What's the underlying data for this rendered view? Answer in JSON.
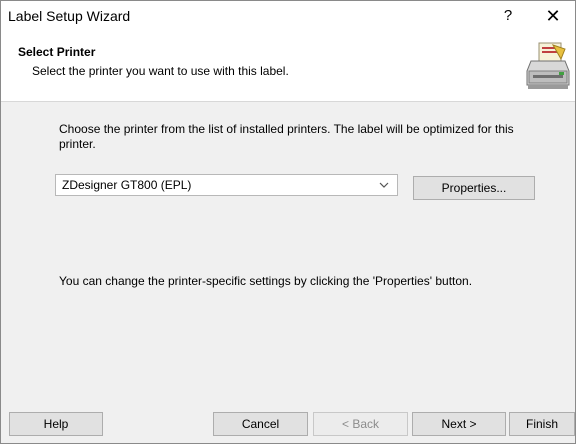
{
  "window": {
    "title": "Label Setup Wizard",
    "help_glyph": "?",
    "close_glyph": "✕"
  },
  "header": {
    "title": "Select Printer",
    "subtitle": "Select the printer you want to use with this label.",
    "icon": "printer-icon"
  },
  "body": {
    "instructions": "Choose the printer from the list of installed printers. The label will be optimized for this printer.",
    "printer_select": {
      "value": "ZDesigner GT800 (EPL)"
    },
    "properties_label": "Properties...",
    "hint": "You can change the printer-specific settings by clicking the 'Properties' button."
  },
  "footer": {
    "help_label": "Help",
    "cancel_label": "Cancel",
    "back_label": "< Back",
    "next_label": "Next >",
    "finish_label": "Finish"
  }
}
